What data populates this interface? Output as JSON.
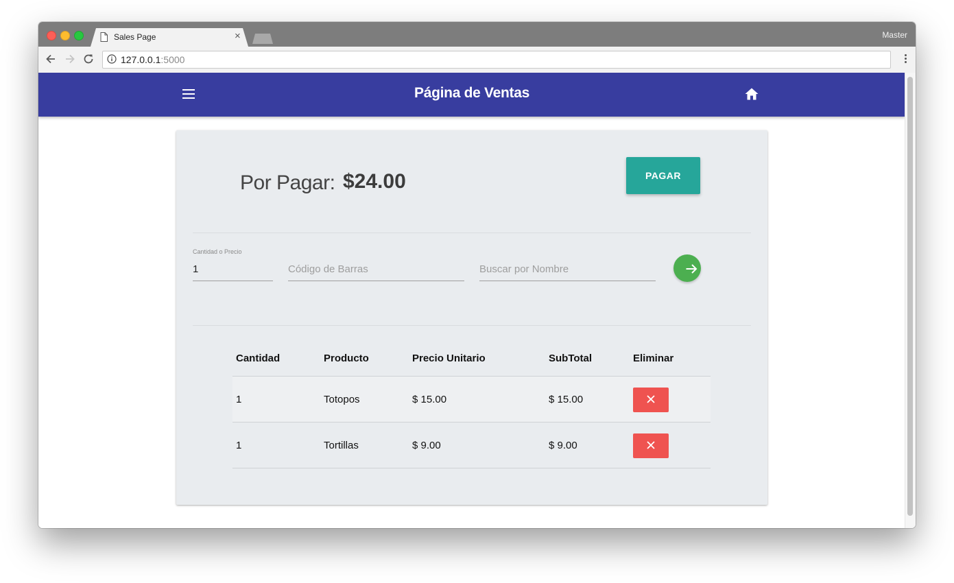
{
  "browser": {
    "tab_title": "Sales Page",
    "profile_name": "Master",
    "url_host": "127.0.0.1",
    "url_port": ":5000"
  },
  "app": {
    "title": "Página de Ventas",
    "color": "#383d9f"
  },
  "summary": {
    "label": "Por Pagar:",
    "total": "$24.00",
    "pay_label": "PAGAR"
  },
  "form": {
    "quantity_label": "Cantidad o Precio",
    "quantity_value": "1",
    "barcode_placeholder": "Código de Barras",
    "name_placeholder": "Buscar por Nombre"
  },
  "table": {
    "headers": [
      "Cantidad",
      "Producto",
      "Precio Unitario",
      "SubTotal",
      "Eliminar"
    ],
    "rows": [
      {
        "cantidad": "1",
        "producto": "Totopos",
        "precio": "$ 15.00",
        "subtotal": "$ 15.00"
      },
      {
        "cantidad": "1",
        "producto": "Tortillas",
        "precio": "$ 9.00",
        "subtotal": "$ 9.00"
      }
    ]
  },
  "colors": {
    "pay_button": "#26a69a",
    "go_button": "#4caf50",
    "delete_button": "#ef5350"
  },
  "icons": {
    "menu": "hamburger-menu-icon",
    "home": "home-icon",
    "go": "arrow-right-icon",
    "delete": "close-icon"
  }
}
